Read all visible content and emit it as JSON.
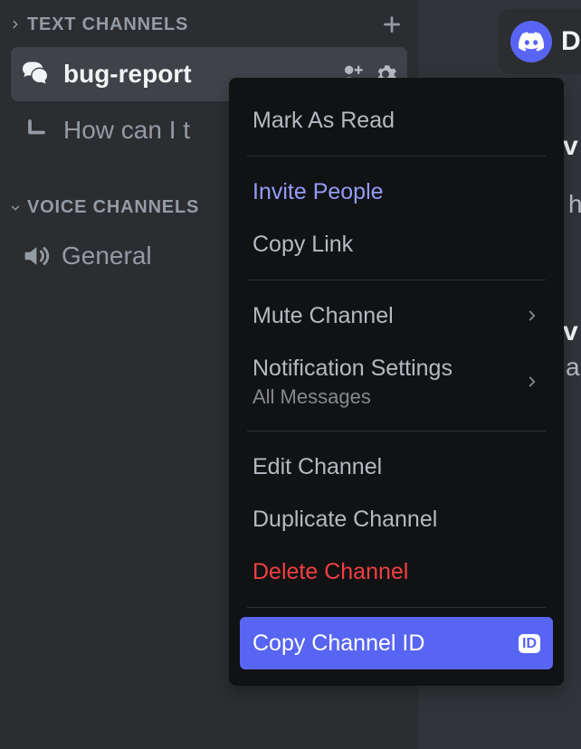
{
  "badge": {
    "label": "Di"
  },
  "right_strip": {
    "v1": "v",
    "h": "h",
    "v2": "v",
    "a": "a"
  },
  "sections": {
    "text": {
      "label": "TEXT CHANNELS"
    },
    "voice": {
      "label": "VOICE CHANNELS"
    }
  },
  "channels": {
    "text": [
      {
        "name": "bug-report"
      },
      {
        "name": "How can I t"
      }
    ],
    "voice": [
      {
        "name": "General"
      }
    ]
  },
  "contextMenu": {
    "markAsRead": "Mark As Read",
    "invitePeople": "Invite People",
    "copyLink": "Copy Link",
    "muteChannel": "Mute Channel",
    "notificationSettings": {
      "label": "Notification Settings",
      "sub": "All Messages"
    },
    "editChannel": "Edit Channel",
    "duplicateChannel": "Duplicate Channel",
    "deleteChannel": "Delete Channel",
    "copyChannelId": "Copy Channel ID",
    "idBadge": "ID"
  }
}
